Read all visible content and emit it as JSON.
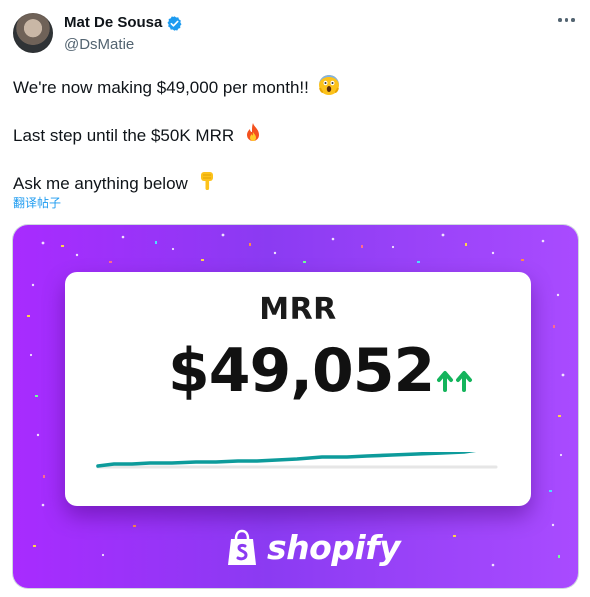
{
  "author": {
    "name": "Mat De Sousa",
    "handle": "@DsMatie",
    "verified": true
  },
  "tweet": {
    "lines": [
      "We're now making $49,000 per month!!",
      "Last step until the $50K MRR",
      "Ask me anything below"
    ],
    "translate_label": "翻译帖子"
  },
  "media": {
    "card": {
      "label": "MRR",
      "value": "$49,052"
    },
    "brand": "shopify",
    "trend": {
      "direction": "up",
      "color": "#0d9b9b"
    }
  },
  "colors": {
    "accent": "#1d9bf0",
    "media_bg": "#9b3cf7",
    "trend_line": "#0d9b9b",
    "up_arrow": "#14b45c"
  },
  "icons": [
    "verified-badge-icon",
    "more-options-icon",
    "face-screaming-emoji-icon",
    "fire-emoji-icon",
    "pointing-down-emoji-icon",
    "trend-up-arrows-icon",
    "shopify-bag-icon"
  ]
}
